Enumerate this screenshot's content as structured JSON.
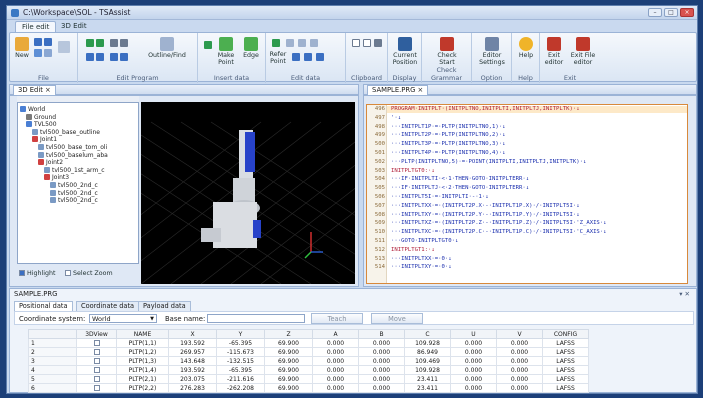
{
  "window": {
    "title": "C:\\Workspace\\SOL - TSAssist"
  },
  "ribbon_tabs": [
    "File edit",
    "3D Edit"
  ],
  "ribbon": {
    "file": {
      "new": "New",
      "label": "File"
    },
    "edit": {
      "outline": "Outline/Find",
      "label": "Edit Program"
    },
    "insert": {
      "make_point": "Make Point",
      "edge": "Edge",
      "label": "Insert data"
    },
    "editdata": {
      "refer_point": "Refer Point",
      "label": "Edit data"
    },
    "clipboard": {
      "label": "Clipboard"
    },
    "display": {
      "current_position": "Current Position",
      "label": "Display"
    },
    "grammar": {
      "check_start": "Check Start",
      "label": "Check Grammar"
    },
    "option": {
      "editor_settings": "Editor Settings",
      "label": "Option"
    },
    "help": {
      "help": "Help",
      "label": "Help"
    },
    "exit": {
      "exit_editor": "Exit editor",
      "exit_file_editor": "Exit File editor",
      "label": "Exit"
    }
  },
  "left_panel": {
    "tab": "3D Edit"
  },
  "tree": [
    {
      "text": "World",
      "color": "#4a7fd4"
    },
    {
      "text": "Ground",
      "color": "#7a7a7a"
    },
    {
      "text": "TVL500",
      "color": "#4a7fd4"
    },
    {
      "text": "tvl500_base_outline",
      "color": "#7a9ac4"
    },
    {
      "text": "Joint1",
      "color": "#d04040"
    },
    {
      "text": "tvl500_base_tom_oli",
      "color": "#7a9ac4"
    },
    {
      "text": "tvl500_baselum_aba",
      "color": "#7a9ac4"
    },
    {
      "text": "Joint2",
      "color": "#d04040"
    },
    {
      "text": "tvl500_1st_arm_c",
      "color": "#7a9ac4"
    },
    {
      "text": "Joint3",
      "color": "#d04040"
    },
    {
      "text": "tvl500_2nd_c",
      "color": "#7a9ac4"
    },
    {
      "text": "tvl500_2nd_c",
      "color": "#7a9ac4"
    },
    {
      "text": "tvl500_2nd_c",
      "color": "#7a9ac4"
    }
  ],
  "left_options": {
    "highlight": "Highlight",
    "select_zoom": "Select Zoom"
  },
  "editor": {
    "tab": "SAMPLE.PRG",
    "lines": [
      {
        "n": "496",
        "text": "PROGRAM·INITPLT·(INITPLTNO,INITPLTI,INITPLTJ,INITPLTK)·↓",
        "kw": true
      },
      {
        "n": "497",
        "text": "'·↓",
        "kw": false
      },
      {
        "n": "498",
        "text": "···INITPLT1P·=·PLTP(INITPLTNO,1)·↓",
        "kw": false
      },
      {
        "n": "499",
        "text": "···INITPLT2P·=·PLTP(INITPLTNO,2)·↓",
        "kw": false
      },
      {
        "n": "500",
        "text": "···INITPLT3P·=·PLTP(INITPLTNO,3)·↓",
        "kw": false
      },
      {
        "n": "501",
        "text": "···INITPLT4P·=·PLTP(INITPLTNO,4)·↓",
        "kw": false
      },
      {
        "n": "502",
        "text": "···PLTP(INITPLTNO,5)·=·POINT(INITPLTI,INITPLTJ,INITPLTK)·↓",
        "kw": false
      },
      {
        "n": "503",
        "text": "INITPLTGT0:·↓",
        "kw": true
      },
      {
        "n": "504",
        "text": "···IF·INITPLTI·<·1·THEN·GOTO·INITPLTERR·↓",
        "kw": false
      },
      {
        "n": "505",
        "text": "···IF·INITPLTJ·<·2·THEN·GOTO·INITPLTERR·↓",
        "kw": false
      },
      {
        "n": "506",
        "text": "···INITPLT5I·=·INITPLTI·-·1·↓",
        "kw": false
      },
      {
        "n": "507",
        "text": "···INITPLTXX·=·(INITPLT2P.X·-·INITPLT1P.X)·/·INITPLT5I·↓",
        "kw": false
      },
      {
        "n": "508",
        "text": "···INITPLTXY·=·(INITPLT2P.Y·-·INITPLT1P.Y)·/·INITPLT5I·↓",
        "kw": false
      },
      {
        "n": "509",
        "text": "···INITPLTXZ·=·(INITPLT2P.Z·-·INITPLT1P.Z)·/·INITPLT5I·'Z_AXIS·↓",
        "kw": false
      },
      {
        "n": "510",
        "text": "···INITPLTXC·=·(INITPLT2P.C·-·INITPLT1P.C)·/·INITPLT5I·'C_AXIS·↓",
        "kw": false
      },
      {
        "n": "511",
        "text": "···GOTO·INITPLTGT0·↓",
        "kw": false
      },
      {
        "n": "512",
        "text": "INITPLTGT1:·↓",
        "kw": true
      },
      {
        "n": "513",
        "text": "···INITPLTXX·=·0·↓",
        "kw": false
      },
      {
        "n": "514",
        "text": "···INITPLTXY·=·0·↓",
        "kw": false
      }
    ]
  },
  "bottom": {
    "title": "SAMPLE.PRG",
    "tabs": [
      "Positional data",
      "Coordinate data",
      "Payload data"
    ],
    "coord_label": "Coordinate system:",
    "coord_value": "World",
    "base_label": "Base name:",
    "teach": "Teach",
    "move": "Move",
    "columns": [
      "",
      "3DView",
      "NAME",
      "X",
      "Y",
      "Z",
      "A",
      "B",
      "C",
      "U",
      "V",
      "CONFIG"
    ],
    "rows": [
      [
        "1",
        "",
        "PLTP(1,1)",
        "193.592",
        "-65.395",
        "69.900",
        "0.000",
        "0.000",
        "109.928",
        "0.000",
        "0.000",
        "LAFSS"
      ],
      [
        "2",
        "",
        "PLTP(1,2)",
        "269.957",
        "-115.673",
        "69.900",
        "0.000",
        "0.000",
        "86.949",
        "0.000",
        "0.000",
        "LAFSS"
      ],
      [
        "3",
        "",
        "PLTP(1,3)",
        "143.648",
        "-132.515",
        "69.900",
        "0.000",
        "0.000",
        "109.469",
        "0.000",
        "0.000",
        "LAFSS"
      ],
      [
        "4",
        "",
        "PLTP(1,4)",
        "193.592",
        "-65.395",
        "69.900",
        "0.000",
        "0.000",
        "109.928",
        "0.000",
        "0.000",
        "LAFSS"
      ],
      [
        "5",
        "",
        "PLTP(2,1)",
        "203.075",
        "-211.616",
        "69.900",
        "0.000",
        "0.000",
        "23.411",
        "0.000",
        "0.000",
        "LAFSS"
      ],
      [
        "6",
        "",
        "PLTP(2,2)",
        "276.283",
        "-262.208",
        "69.900",
        "0.000",
        "0.000",
        "23.411",
        "0.000",
        "0.000",
        "LAFSS"
      ]
    ]
  }
}
